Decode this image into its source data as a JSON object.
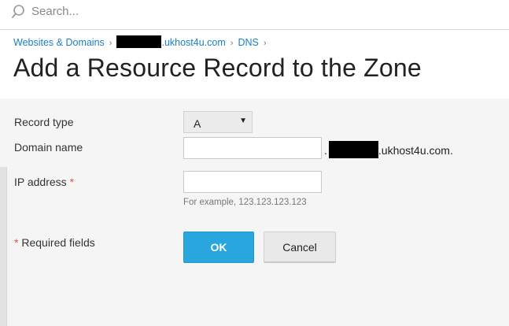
{
  "search": {
    "placeholder": "Search..."
  },
  "breadcrumb": {
    "items": [
      {
        "label": "Websites & Domains"
      },
      {
        "label": ".ukhost4u.com",
        "redacted_prefix": true
      },
      {
        "label": "DNS"
      }
    ],
    "separator": "›"
  },
  "page": {
    "title": "Add a Resource Record to the Zone"
  },
  "form": {
    "record_type": {
      "label": "Record type",
      "value": "A",
      "arrow": "▼"
    },
    "domain_name": {
      "label": "Domain name",
      "value": "",
      "suffix_dot": ".",
      "suffix_domain": ".ukhost4u.com."
    },
    "ip_address": {
      "label": "IP address",
      "required_mark": "*",
      "value": "",
      "hint": "For example, 123.123.123.123"
    },
    "required_note": {
      "mark": "*",
      "text": "Required fields"
    }
  },
  "buttons": {
    "ok_label": "OK",
    "cancel_label": "Cancel"
  },
  "colors": {
    "accent": "#2aa6df",
    "link": "#1a7fc1",
    "required": "#d9534f"
  }
}
